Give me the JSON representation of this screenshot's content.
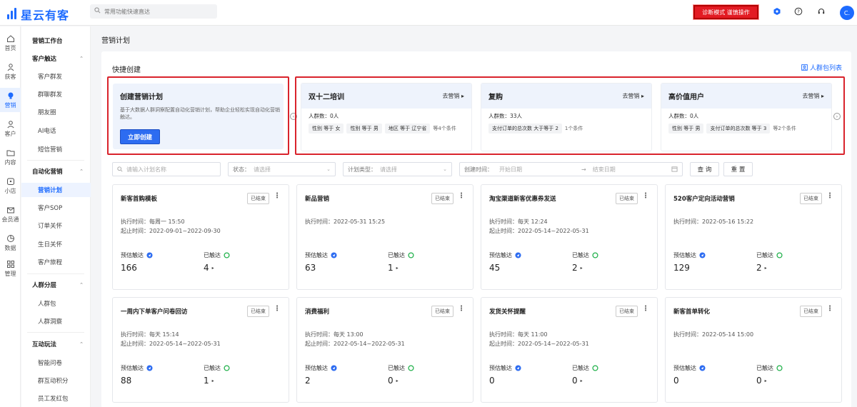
{
  "app": {
    "brand": "星云有客",
    "search_placeholder": "常用功能快速直达",
    "diagnose_label": "诊断模式 谨慎操作",
    "avatar_text": "C."
  },
  "icon_nav": [
    {
      "label": "首页",
      "icon": "home-icon"
    },
    {
      "label": "获客",
      "icon": "user-plus-icon"
    },
    {
      "label": "营销",
      "icon": "bulb-icon"
    },
    {
      "label": "客户",
      "icon": "person-icon"
    },
    {
      "label": "内容",
      "icon": "folder-icon"
    },
    {
      "label": "小店",
      "icon": "store-icon"
    },
    {
      "label": "会员通",
      "icon": "member-icon"
    },
    {
      "label": "数据",
      "icon": "chart-icon"
    },
    {
      "label": "管理",
      "icon": "grid-icon"
    }
  ],
  "side_nav": {
    "workbench": "营销工作台",
    "groups": [
      {
        "title": "客户触达",
        "items": [
          "客户群发",
          "群聊群发",
          "朋友圈",
          "AI电话",
          "短信营销"
        ]
      },
      {
        "title": "自动化营销",
        "items": [
          "营销计划",
          "客户SOP",
          "订单关怀",
          "生日关怀",
          "客户旅程"
        ]
      },
      {
        "title": "人群分层",
        "items": [
          "人群包",
          "人群洞察"
        ]
      },
      {
        "title": "互动玩法",
        "items": [
          "智能问卷",
          "群互动积分",
          "员工发红包"
        ]
      }
    ]
  },
  "page_title": "营销计划",
  "quick": {
    "title": "快捷创建",
    "crowd_link": "人群包列表",
    "create": {
      "title": "创建营销计划",
      "desc": "基于大数据人群洞察配置自动化营销计划，帮助企业轻松实现自动化营销触达。",
      "button": "立即创建"
    },
    "segments": [
      {
        "name": "双十二培训",
        "go": "去营销",
        "count": "人群数：0人",
        "chips": [
          "性别 等于 女",
          "性别 等于 男",
          "地区 等于 辽宁省"
        ],
        "more": "等4个条件"
      },
      {
        "name": "复购",
        "go": "去营销",
        "count": "人群数：33人",
        "chips": [
          "支付订单的总次数 大于等于 2"
        ],
        "more": "1个条件"
      },
      {
        "name": "高价值用户",
        "go": "去营销",
        "count": "人群数：0人",
        "chips": [
          "性别 等于 男",
          "支付订单的总次数 等于 3"
        ],
        "more": "等2个条件"
      }
    ]
  },
  "filters": {
    "name_placeholder": "请输入计划名称",
    "status_label": "状态：",
    "status_placeholder": "请选择",
    "type_label": "计划类型：",
    "type_placeholder": "请选择",
    "time_label": "创建时间：",
    "start_placeholder": "开始日期",
    "end_placeholder": "结束日期",
    "query": "查 询",
    "reset": "重 置"
  },
  "plans": [
    {
      "title": "新客首购模板",
      "status": "已结束",
      "exec": "执行时间：每周一 15:50",
      "range": "起止时间：2022-09-01~2022-09-30",
      "est_label": "预估触达",
      "est": "166",
      "reach_label": "已触达",
      "reach": "4"
    },
    {
      "title": "新品营销",
      "status": "已结束",
      "exec": "执行时间：2022-05-31 15:25",
      "range": "",
      "est_label": "预估触达",
      "est": "63",
      "reach_label": "已触达",
      "reach": "1"
    },
    {
      "title": "淘宝渠道新客优惠券发送",
      "status": "已结束",
      "exec": "执行时间：每天 12:24",
      "range": "起止时间：2022-05-14~2022-05-31",
      "est_label": "预估触达",
      "est": "45",
      "reach_label": "已触达",
      "reach": "2"
    },
    {
      "title": "520客户定向活动营销",
      "status": "已结束",
      "exec": "执行时间：2022-05-16 15:22",
      "range": "",
      "est_label": "预估触达",
      "est": "129",
      "reach_label": "已触达",
      "reach": "2"
    },
    {
      "title": "一周内下单客户问卷回访",
      "status": "已结束",
      "exec": "执行时间：每天 15:14",
      "range": "起止时间：2022-05-14~2022-05-31",
      "est_label": "预估触达",
      "est": "88",
      "reach_label": "已触达",
      "reach": "1"
    },
    {
      "title": "消费福利",
      "status": "已结束",
      "exec": "执行时间：每天 13:00",
      "range": "起止时间：2022-05-14~2022-05-31",
      "est_label": "预估触达",
      "est": "2",
      "reach_label": "已触达",
      "reach": "0"
    },
    {
      "title": "发货关怀提醒",
      "status": "已结束",
      "exec": "执行时间：每天 11:00",
      "range": "起止时间：2022-05-14~2022-05-31",
      "est_label": "预估触达",
      "est": "0",
      "reach_label": "已触达",
      "reach": "0"
    },
    {
      "title": "新客首单转化",
      "status": "已结束",
      "exec": "执行时间：2022-05-14 15:00",
      "range": "",
      "est_label": "预估触达",
      "est": "0",
      "reach_label": "已触达",
      "reach": "0"
    }
  ],
  "colors": {
    "brand": "#1d6bff",
    "danger": "#e31b23",
    "estimate_icon": "#2d6cf1",
    "reach_icon": "#21b14b"
  }
}
